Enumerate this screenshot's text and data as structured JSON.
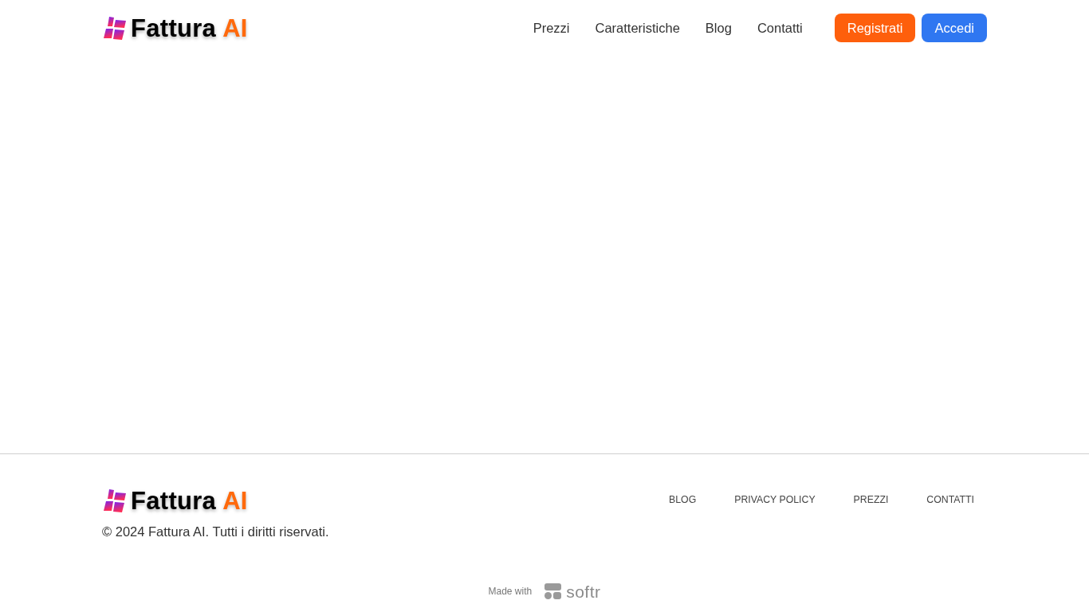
{
  "header": {
    "logo": {
      "name": "Fattura",
      "accent": "AI"
    },
    "nav": [
      {
        "label": "Prezzi"
      },
      {
        "label": "Caratteristiche"
      },
      {
        "label": "Blog"
      },
      {
        "label": "Contatti"
      }
    ],
    "buttons": [
      {
        "label": "Registrati",
        "kind": "primary"
      },
      {
        "label": "Accedi",
        "kind": "secondary"
      }
    ]
  },
  "footer": {
    "logo": {
      "name": "Fattura",
      "accent": "AI"
    },
    "copyright": "© 2024 Fattura AI. Tutti i diritti riservati.",
    "links": [
      {
        "label": "BLOG"
      },
      {
        "label": "PRIVACY POLICY"
      },
      {
        "label": "PREZZI"
      },
      {
        "label": "CONTATTI"
      }
    ]
  },
  "made_with": {
    "label": "Made with",
    "brand": "softr"
  }
}
